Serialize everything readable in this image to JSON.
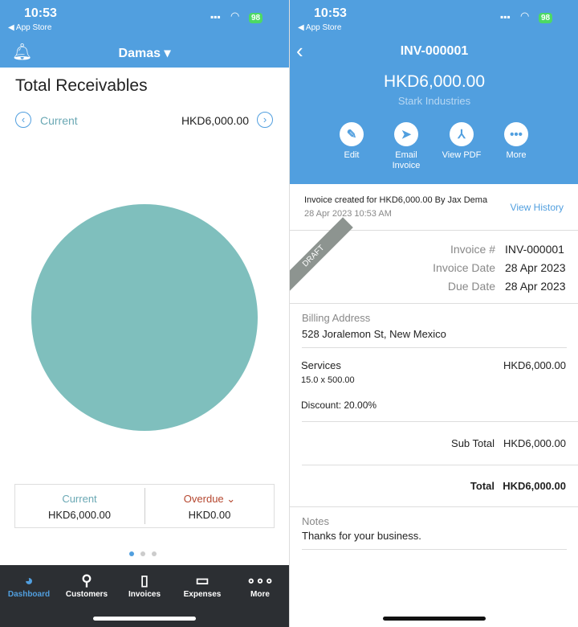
{
  "status": {
    "time": "10:53",
    "back": "◀ App Store",
    "battery": "98"
  },
  "left": {
    "org": "Damas ▾",
    "title": "Total Receivables",
    "period": "Current",
    "period_amount": "HKD6,000.00",
    "chart_data": {
      "type": "pie",
      "categories": [
        "Current",
        "Overdue"
      ],
      "values": [
        6000,
        0
      ],
      "colors": [
        "#7fbfbd",
        "#c0392b"
      ]
    },
    "summary": {
      "current_label": "Current",
      "current_value": "HKD6,000.00",
      "overdue_label": "Overdue",
      "overdue_value": "HKD0.00"
    },
    "tabs": [
      {
        "label": "Dashboard",
        "icon": "dashboard-icon",
        "active": true
      },
      {
        "label": "Customers",
        "icon": "person-icon"
      },
      {
        "label": "Invoices",
        "icon": "document-icon"
      },
      {
        "label": "Expenses",
        "icon": "wallet-icon"
      },
      {
        "label": "More",
        "icon": "more-icon"
      }
    ]
  },
  "right": {
    "title": "INV-000001",
    "amount": "HKD6,000.00",
    "customer": "Stark Industries",
    "actions": [
      {
        "label": "Edit",
        "icon": "pencil-icon"
      },
      {
        "label": "Email Invoice",
        "icon": "paper-plane-icon"
      },
      {
        "label": "View PDF",
        "icon": "pdf-icon"
      },
      {
        "label": "More",
        "icon": "more-icon"
      }
    ],
    "activity": {
      "text": "Invoice created for HKD6,000.00 By Jax Dema",
      "time": "28 Apr 2023 10:53 AM",
      "link": "View History"
    },
    "ribbon": "DRAFT",
    "fields": [
      {
        "label": "Invoice #",
        "value": "INV-000001"
      },
      {
        "label": "Invoice Date",
        "value": "28 Apr 2023"
      },
      {
        "label": "Due Date",
        "value": "28 Apr 2023"
      }
    ],
    "billing_label": "Billing Address",
    "billing": "528 Joralemon St, New Mexico",
    "item": {
      "name": "Services",
      "amount": "HKD6,000.00",
      "qty": "15.0 x 500.00",
      "discount": "Discount: 20.00%"
    },
    "subtotal_label": "Sub Total",
    "subtotal": "HKD6,000.00",
    "total_label": "Total",
    "total": "HKD6,000.00",
    "notes_label": "Notes",
    "notes": "Thanks for your business."
  }
}
